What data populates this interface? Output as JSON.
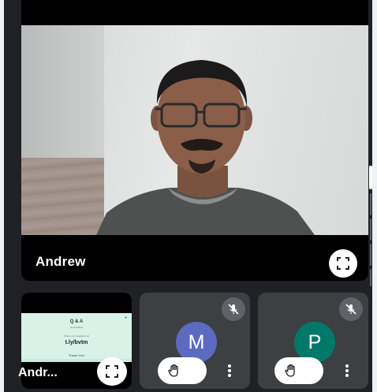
{
  "main_participant": {
    "name": "Andrew",
    "fullscreen_icon": "fullscreen-icon"
  },
  "presentation_tile": {
    "name_truncated": "Andr...",
    "slide": {
      "title": "Q & A",
      "subtitle": "presentation",
      "small_text": "Share your questions at",
      "link": "t.ly/bvtm",
      "thanks": "Thank You!"
    },
    "fullscreen_icon": "fullscreen-icon"
  },
  "participants": [
    {
      "initial": "M",
      "avatar_color": "#5c6bc0",
      "muted": true
    },
    {
      "initial": "P",
      "avatar_color": "#00796b",
      "muted": true
    }
  ],
  "icons": {
    "mic_off": "mic-off-icon",
    "raise_hand": "raise-hand-icon",
    "more": "more-vert-icon"
  }
}
